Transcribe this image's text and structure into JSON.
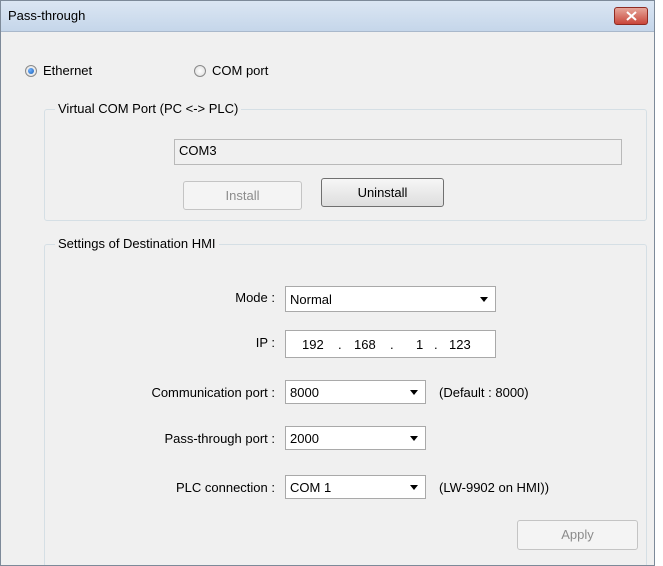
{
  "window": {
    "title": "Pass-through"
  },
  "connection": {
    "ethernet_label": "Ethernet",
    "com_port_label": "COM port",
    "selected": "Ethernet"
  },
  "virtual_com": {
    "legend": "Virtual COM Port (PC <-> PLC)",
    "port_value": "COM3",
    "install_label": "Install",
    "uninstall_label": "Uninstall"
  },
  "settings": {
    "legend": "Settings of Destination HMI",
    "mode_label": "Mode :",
    "mode_value": "Normal",
    "ip_label": "IP :",
    "ip": {
      "o1": "192",
      "o2": "168",
      "o3": "1",
      "o4": "123",
      "dot": "."
    },
    "comm_port_label": "Communication port :",
    "comm_port_value": "8000",
    "comm_port_note": "(Default : 8000)",
    "pass_port_label": "Pass-through port :",
    "pass_port_value": "2000",
    "plc_conn_label": "PLC connection :",
    "plc_conn_value": "COM 1",
    "plc_conn_note": "(LW-9902 on HMI))",
    "apply_label": "Apply"
  }
}
